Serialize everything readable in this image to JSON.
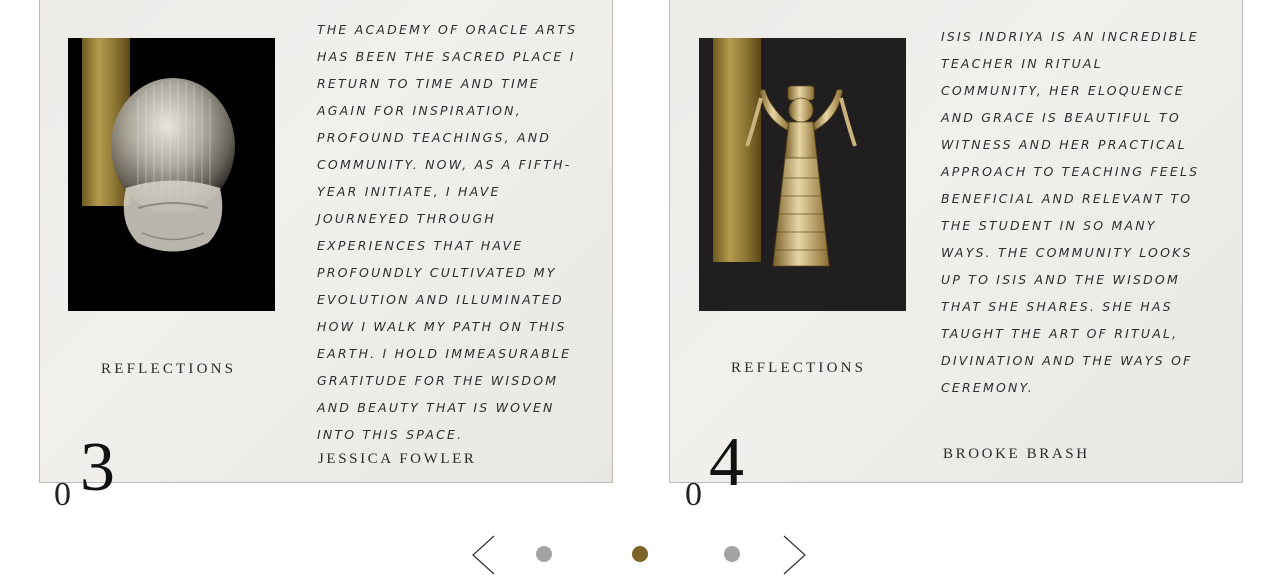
{
  "cards": [
    {
      "section_label": "REFLECTIONS",
      "quote": "The Academy of Oracle Arts has been the sacred place I return to time and time again for inspiration, profound teachings, and community. Now, as a fifth-year initiate, I have journeyed through experiences that have profoundly cultivated my evolution and illuminated how I walk my path on this earth. I hold immeasurable gratitude for the wisdom and beauty that is woven into this space.",
      "author": "JESSICA FOWLER",
      "index_prefix": "0",
      "index_digit": "3",
      "image_icon": "crystal-scarab-icon"
    },
    {
      "section_label": "REFLECTIONS",
      "quote": "Isis Indriya is an incredible teacher in ritual community, her eloquence and grace is beautiful to witness and her practical approach to teaching feels beneficial and relevant to the student in so many ways. The community looks up to Isis and the wisdom that she shares. She has taught the art of ritual, divination and the ways of ceremony.",
      "author": "BROOKE BRASH",
      "index_prefix": "0",
      "index_digit": "4",
      "image_icon": "snake-goddess-figurine-icon"
    }
  ],
  "carousel": {
    "prev_icon": "chevron-left-icon",
    "next_icon": "chevron-right-icon",
    "dot_count": 3,
    "active_dot": 2
  },
  "colors": {
    "dot_inactive": "#a3a3a3",
    "dot_active": "#7e6428",
    "gold": "#b59a4d"
  }
}
